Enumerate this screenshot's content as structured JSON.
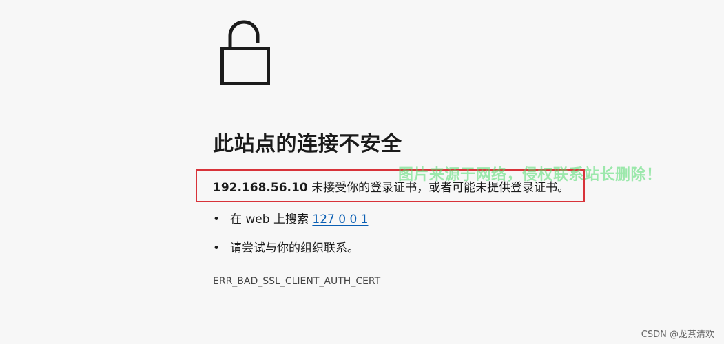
{
  "page": {
    "heading": "此站点的连接不安全",
    "message": {
      "host": "192.168.56.10",
      "text": " 未接受你的登录证书，或者可能未提供登录证书。"
    },
    "suggestions": {
      "search_prefix": "在 web 上搜索 ",
      "search_link": "127 0 0 1",
      "contact_text": "请尝试与你的组织联系。",
      "bullet": "•"
    },
    "error_code": "ERR_BAD_SSL_CLIENT_AUTH_CERT"
  },
  "overlay": {
    "watermark": "图片来源于网络，侵权联系站长删除！",
    "credit": "CSDN @龙茶清欢"
  },
  "colors": {
    "highlight_border": "#d8333a",
    "link": "#0a5fb4",
    "watermark": "#50dc6e"
  },
  "icons": {
    "lock": "unlocked-padlock-icon"
  }
}
